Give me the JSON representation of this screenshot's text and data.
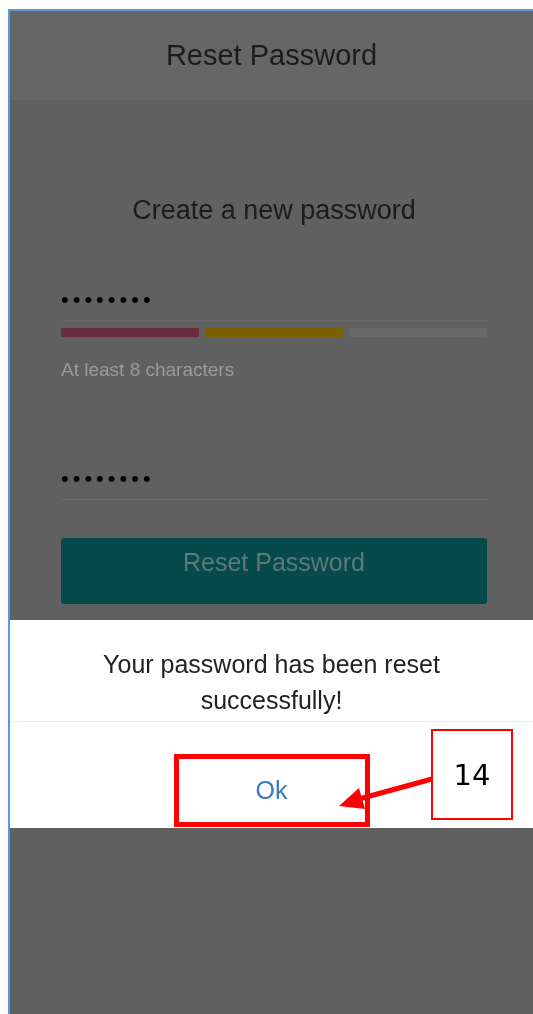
{
  "header": {
    "title": "Reset Password"
  },
  "form": {
    "heading": "Create a new password",
    "new_password": {
      "value": "••••••••"
    },
    "strength_segments": [
      {
        "color": "#6a2c40"
      },
      {
        "color": "#7a6100"
      },
      {
        "color": "#686868"
      }
    ],
    "hint": "At least 8 characters",
    "confirm_password": {
      "value": "••••••••"
    },
    "submit_button": "Reset Password"
  },
  "dialog": {
    "message": "Your password has been reset successfully!",
    "button": "Ok"
  },
  "annotation": {
    "callout": "14"
  }
}
